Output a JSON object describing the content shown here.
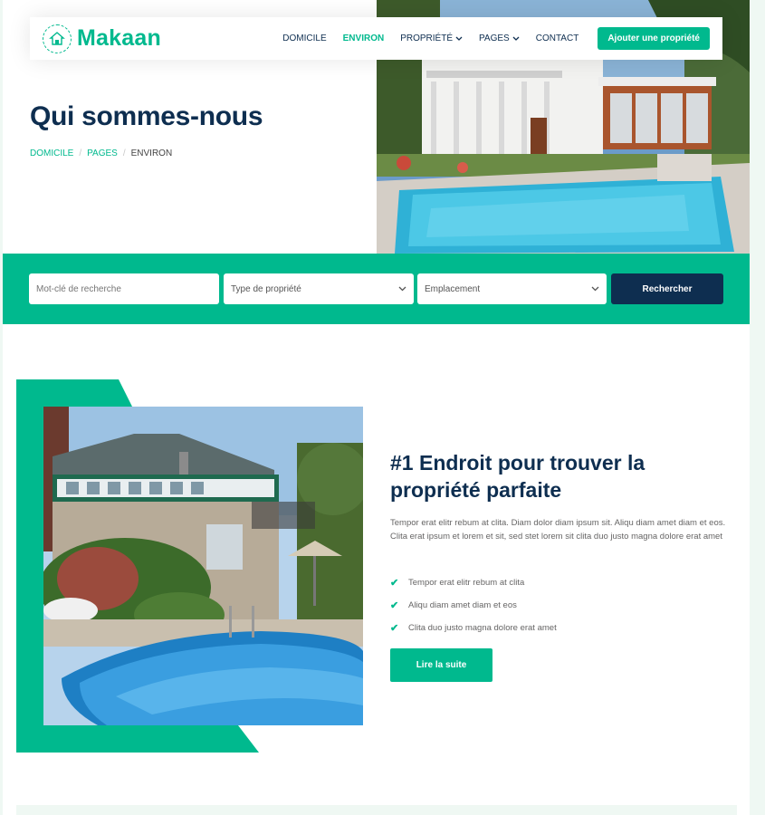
{
  "brand": {
    "name": "Makaan",
    "accent": "#00b98e",
    "dark": "#0e2e50"
  },
  "nav": {
    "items": [
      {
        "label": "DOMICILE",
        "active": false,
        "dropdown": false
      },
      {
        "label": "ENVIRON",
        "active": true,
        "dropdown": false
      },
      {
        "label": "PROPRIÉTÉ",
        "active": false,
        "dropdown": true
      },
      {
        "label": "PAGES",
        "active": false,
        "dropdown": true
      },
      {
        "label": "CONTACT",
        "active": false,
        "dropdown": false
      }
    ],
    "cta": "Ajouter une propriété"
  },
  "hero": {
    "title": "Qui sommes-nous",
    "breadcrumb": {
      "home": "DOMICILE",
      "pages": "PAGES",
      "current": "ENVIRON",
      "sep": "/"
    }
  },
  "search": {
    "keyword_placeholder": "Mot-clé de recherche",
    "type_selected": "Type de propriété",
    "location_selected": "Emplacement",
    "button": "Rechercher"
  },
  "about": {
    "title": "#1 Endroit pour trouver la propriété parfaite",
    "text": "Tempor erat elitr rebum at clita. Diam dolor diam ipsum sit. Aliqu diam amet diam et eos. Clita erat ipsum et lorem et sit, sed stet lorem sit clita duo justo magna dolore erat amet",
    "checks": [
      "Tempor erat elitr rebum at clita",
      "Aliqu diam amet diam et eos",
      "Clita duo justo magna dolore erat amet"
    ],
    "button": "Lire la suite"
  }
}
